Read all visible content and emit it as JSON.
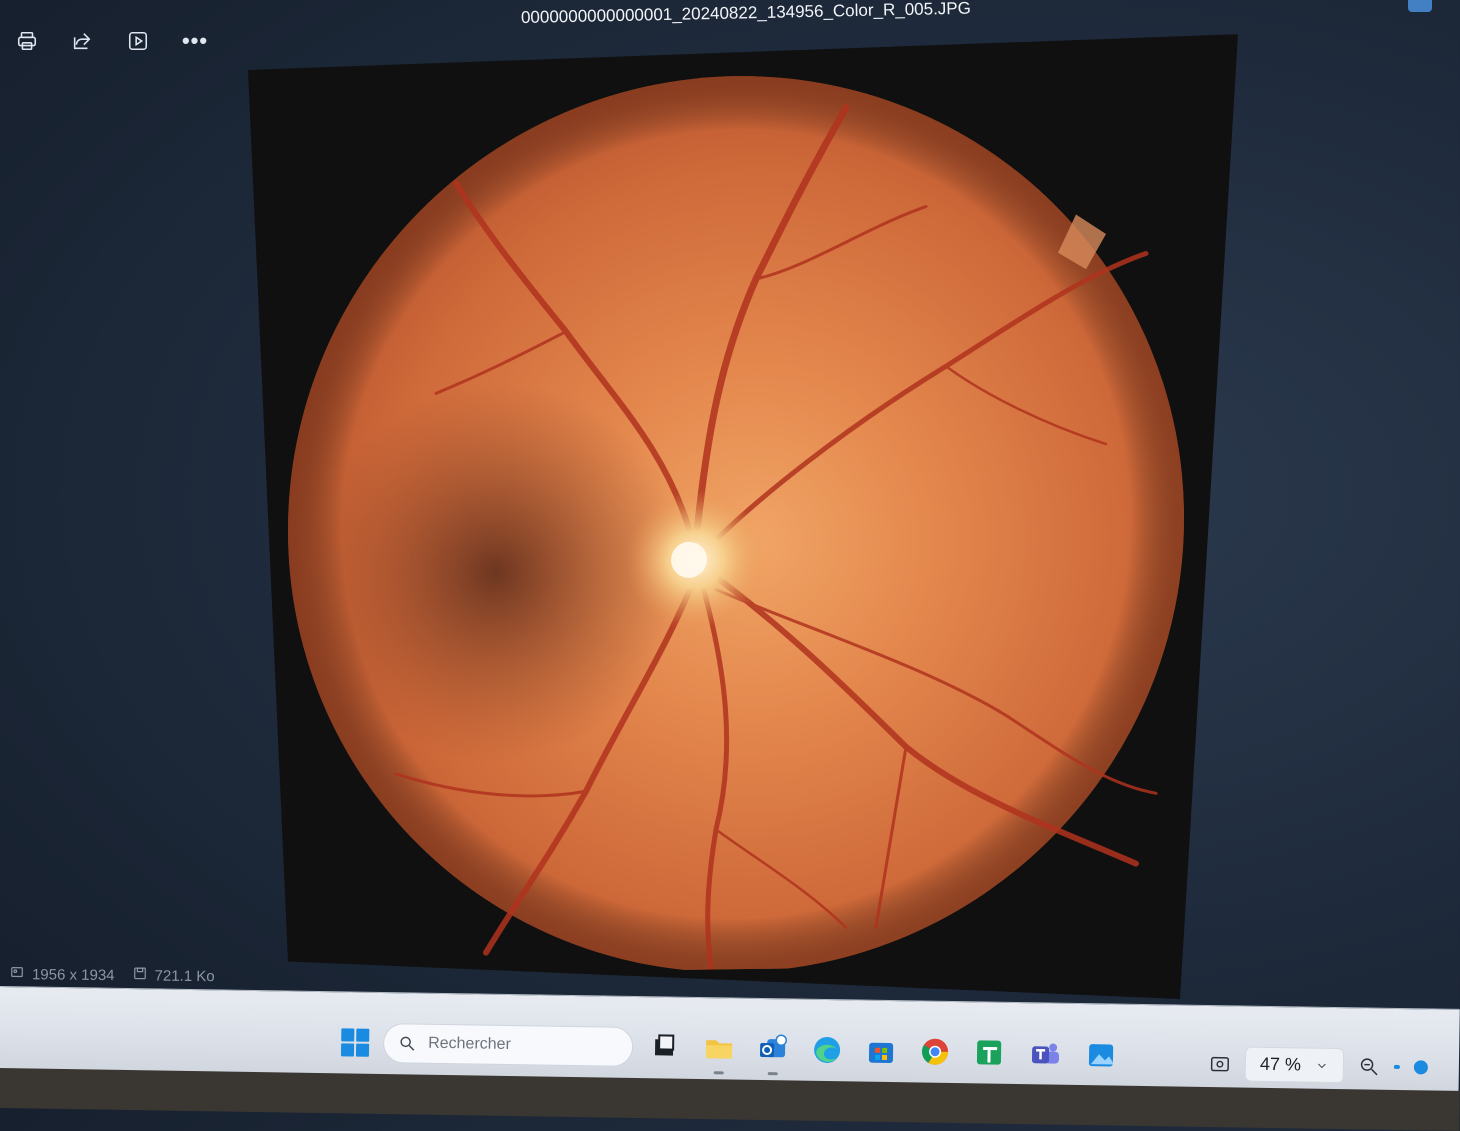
{
  "window": {
    "file_name": "0000000000000001_20240822_134956_Color_R_005.JPG"
  },
  "toolbar": {
    "buttons": [
      {
        "name": "print",
        "icon": "printer-icon"
      },
      {
        "name": "share",
        "icon": "share-icon"
      },
      {
        "name": "slideshow",
        "icon": "play-icon"
      },
      {
        "name": "more",
        "icon": "more-icon",
        "label": "•••"
      }
    ]
  },
  "image": {
    "description_icon": "fundus-photo"
  },
  "status": {
    "dimensions": "1956 x 1934",
    "file_size": "721.1 Ko"
  },
  "taskbar": {
    "search_placeholder": "Rechercher",
    "apps": [
      "task-view",
      "file-explorer",
      "outlook",
      "edge",
      "store",
      "chrome",
      "sheets",
      "teams",
      "photos"
    ],
    "zoom": "47 %",
    "accent_color": "#1a8be0"
  }
}
